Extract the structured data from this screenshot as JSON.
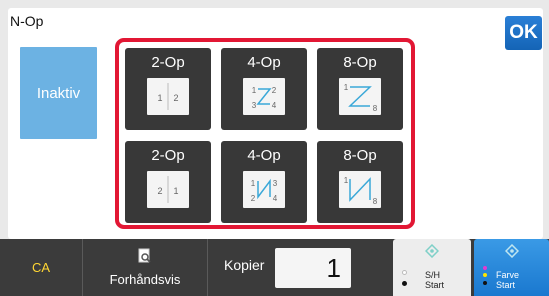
{
  "header": {
    "title": "N-Op",
    "ok_label": "OK"
  },
  "left_option": {
    "label": "Inaktiv"
  },
  "options": [
    {
      "label": "2-Op",
      "pages": [
        "1",
        "2"
      ]
    },
    {
      "label": "4-Op",
      "pages": [
        "1",
        "2",
        "3",
        "4"
      ]
    },
    {
      "label": "8-Op",
      "pages": [
        "1",
        "8"
      ]
    },
    {
      "label": "2-Op",
      "pages": [
        "2",
        "1"
      ]
    },
    {
      "label": "4-Op",
      "pages": [
        "1",
        "3",
        "2",
        "4"
      ]
    },
    {
      "label": "8-Op",
      "pages": [
        "1",
        "8"
      ]
    }
  ],
  "colors": {
    "selection_frame": "#e21734",
    "ok_button": "#1a70c6",
    "inaktiv": "#6cb2e3"
  },
  "bottom_bar": {
    "ca_label": "CA",
    "preview_label": "Forhåndsvis",
    "copies_label": "Kopier",
    "copies_value": "1",
    "bw_start": {
      "line1": "S/H",
      "line2": "Start"
    },
    "color_start": {
      "line1": "Farve",
      "line2": "Start"
    }
  }
}
